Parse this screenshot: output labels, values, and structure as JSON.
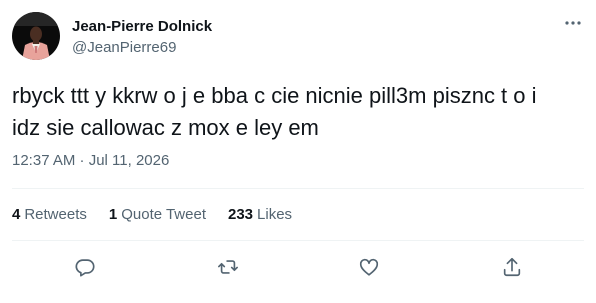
{
  "author": {
    "name": "Jean-Pierre Dolnick",
    "handle": "@JeanPierre69"
  },
  "tweet": {
    "text_line1": "rbyck ttt y kkrw o j e bba c cie nicnie pill3m pisznc t o i",
    "text_line2": "idz sie callowac z mox e ley em",
    "timestamp": "12:37 AM · Jul 11, 2026"
  },
  "stats": {
    "retweets_count": "4",
    "retweets_label": "Retweets",
    "quotes_count": "1",
    "quotes_label": "Quote Tweet",
    "likes_count": "233",
    "likes_label": "Likes"
  },
  "icons": {
    "more": "more-dots-icon",
    "reply": "reply-icon",
    "retweet": "retweet-icon",
    "like": "heart-icon",
    "share": "share-icon"
  },
  "colors": {
    "text": "#0f1419",
    "secondary": "#536471",
    "divider": "#eff3f4"
  }
}
